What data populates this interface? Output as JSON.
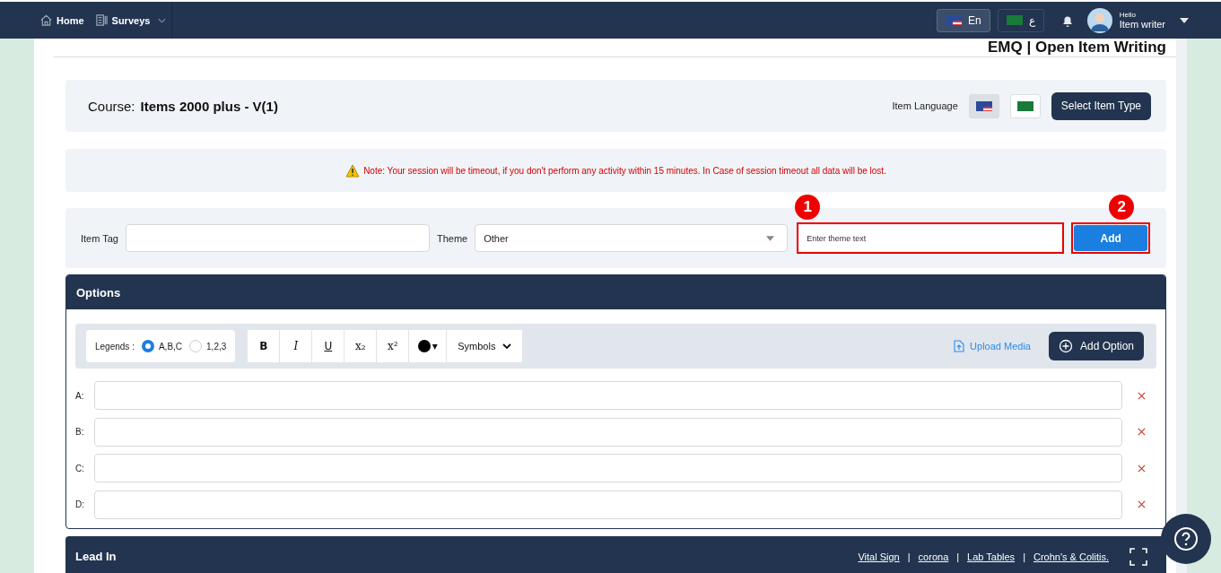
{
  "navbar": {
    "links": [
      {
        "label": "Home"
      },
      {
        "label": "Surveys"
      }
    ],
    "languages": [
      {
        "label": "En",
        "selected": true
      },
      {
        "label": "ع",
        "selected": false
      }
    ],
    "user": {
      "greeting": "Hello",
      "name": "Item writer"
    }
  },
  "page_title": "EMQ | Open Item Writing",
  "course": {
    "label": "Course:",
    "name": "Items 2000 plus - V(1)",
    "language_label": "Item Language",
    "item_languages": [
      {
        "selected": true
      },
      {
        "selected": false
      }
    ],
    "button": "Select Item Type"
  },
  "note": "Note: Your session will be timeout, if you don't perform any activity within 15 minutes. In Case of session timeout all data will be lost.",
  "tag_row": {
    "item_tag_label": "Item Tag",
    "theme_label": "Theme",
    "theme_value": "Other",
    "theme_text_placeholder": "Enter theme text",
    "add_button": "Add",
    "callouts": [
      "1",
      "2"
    ]
  },
  "options": {
    "title": "Options",
    "legends_label": "Legends :",
    "legends": [
      {
        "label": "A,B,C",
        "selected": true
      },
      {
        "label": "1,2,3",
        "selected": false
      }
    ],
    "format_buttons": [
      {
        "label": "B",
        "kind": "bold"
      },
      {
        "label": "I",
        "kind": "italic"
      },
      {
        "label": "U",
        "kind": "underline"
      },
      {
        "label": "x₂",
        "kind": "sub"
      },
      {
        "label": "x²",
        "kind": "sup"
      }
    ],
    "color_caret": "▾",
    "symbols": "Symbols",
    "upload": "Upload Media",
    "add_option": "Add Option",
    "rows": [
      {
        "label": "A:"
      },
      {
        "label": "B:"
      },
      {
        "label": "C:"
      },
      {
        "label": "D:"
      }
    ]
  },
  "lead_in": {
    "title": "Lead In",
    "links": [
      "Vital Sign",
      "corona",
      "Lab Tables",
      "Crohn's & Colitis."
    ],
    "separator": "|"
  }
}
